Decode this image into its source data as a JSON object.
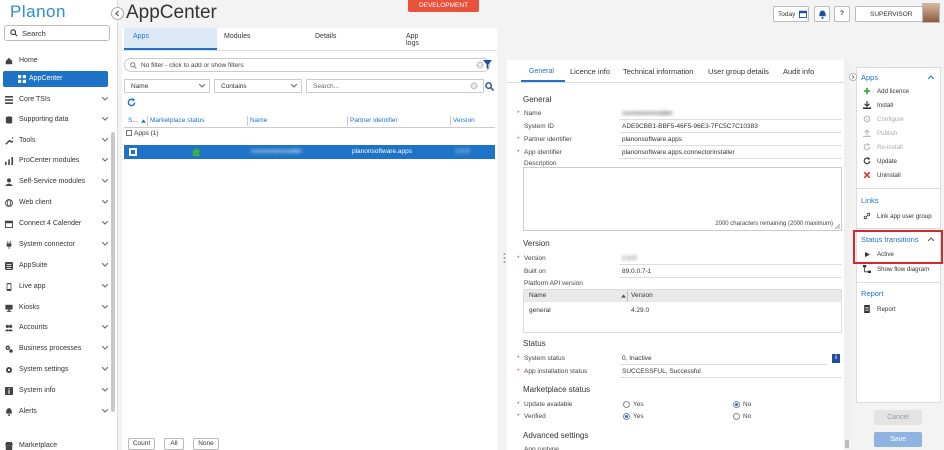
{
  "logo": "Planon",
  "sidebar": {
    "search_label": "Search",
    "items": [
      {
        "label": "Home",
        "icon": "home-icon"
      },
      {
        "label": "AppCenter",
        "icon": "apps-icon"
      },
      {
        "label": "Core TSIs",
        "icon": "grid-icon"
      },
      {
        "label": "Supporting data",
        "icon": "database-icon"
      },
      {
        "label": "Tools",
        "icon": "wrench-icon"
      },
      {
        "label": "ProCenter modules",
        "icon": "chart-icon"
      },
      {
        "label": "Self-Service modules",
        "icon": "user-icon"
      },
      {
        "label": "Web client",
        "icon": "globe-icon"
      },
      {
        "label": "Connect 4 Calender",
        "icon": "calendar-icon"
      },
      {
        "label": "System connector",
        "icon": "plug-icon"
      },
      {
        "label": "AppSuite",
        "icon": "list-icon"
      },
      {
        "label": "Live app",
        "icon": "phone-icon"
      },
      {
        "label": "Kiosks",
        "icon": "monitor-icon"
      },
      {
        "label": "Accounts",
        "icon": "users-icon"
      },
      {
        "label": "Business processes",
        "icon": "gears-icon"
      },
      {
        "label": "System settings",
        "icon": "gear-icon"
      },
      {
        "label": "System info",
        "icon": "info-icon"
      },
      {
        "label": "Alerts",
        "icon": "alert-icon"
      },
      {
        "label": "Marketplace",
        "icon": "store-icon"
      }
    ]
  },
  "header": {
    "title": "AppCenter",
    "environment": "DEVELOPMENT",
    "today": "Today",
    "help": "?",
    "user": "SUPERVISOR"
  },
  "left_tabs": [
    "Apps",
    "Modules",
    "Details",
    "App logs"
  ],
  "filter_text": "No filter - click to add or show filters",
  "condition": {
    "field": "Name",
    "operator": "Contains",
    "value_placeholder": "Search..."
  },
  "grid": {
    "columns": [
      "S...",
      "Marketplace status",
      "Name",
      "Partner identifier",
      "Version"
    ],
    "group_label": "Apps (1)",
    "row": {
      "name": "connectorinstaller",
      "partner": "planonsoftware.apps",
      "version": "1.0.0"
    }
  },
  "bottom_buttons": [
    "Count",
    "All",
    "None"
  ],
  "detail_tabs": [
    "General",
    "Licence info",
    "Technical information",
    "User group details",
    "Audit info"
  ],
  "general": {
    "section": "General",
    "fields": [
      {
        "label": "Name",
        "value": "connectorinstaller",
        "required": true,
        "blur": true
      },
      {
        "label": "System ID",
        "value": "ADE9CBB1-BBF5-46F5-96E3-7FC5C7C10383",
        "required": false,
        "blur": false
      },
      {
        "label": "Partner identifier",
        "value": "planonsoftware.apps",
        "required": true,
        "blur": false
      },
      {
        "label": "App identifier",
        "value": "planonsoftware.apps.connectorinstaller",
        "required": true,
        "blur": false
      }
    ],
    "description_label": "Description",
    "char_count": "2000 characters remaining (2000 maximum)"
  },
  "version": {
    "section": "Version",
    "version_label": "Version",
    "version_value": "1.0.0",
    "built_on_label": "Built on",
    "built_on_value": "89.0.0.7-1",
    "api_label": "Platform API version",
    "api_cols": [
      "Name",
      "Version"
    ],
    "api_row": {
      "name": "general",
      "version": "4.29.0"
    }
  },
  "status": {
    "section": "Status",
    "system_label": "System status",
    "system_value": "0, Inactive",
    "install_label": "App installation status",
    "install_value": "SUCCESSFUL, Successful"
  },
  "marketplace": {
    "section": "Marketplace status",
    "update_label": "Update available",
    "verified_label": "Verified",
    "yes": "Yes",
    "no": "No",
    "update_available": "No",
    "verified": "Yes"
  },
  "advanced": {
    "section": "Advanced settings",
    "first_label": "App runtype"
  },
  "actions": {
    "apps_title": "Apps",
    "apps_items": [
      {
        "label": "Add licence",
        "icon": "plus-icon",
        "enabled": true
      },
      {
        "label": "Install",
        "icon": "download-icon",
        "enabled": true
      },
      {
        "label": "Configure",
        "icon": "configure-icon",
        "enabled": false
      },
      {
        "label": "Publish",
        "icon": "publish-icon",
        "enabled": false
      },
      {
        "label": "Re-install",
        "icon": "reinstall-icon",
        "enabled": false
      },
      {
        "label": "Update",
        "icon": "refresh-icon",
        "enabled": true
      },
      {
        "label": "Uninstall",
        "icon": "close-icon",
        "enabled": true
      }
    ],
    "links_title": "Links",
    "links_items": [
      {
        "label": "Link app user group",
        "icon": "link-icon"
      }
    ],
    "status_title": "Status transitions",
    "status_items": [
      {
        "label": "Active",
        "icon": "arrow-right-icon"
      }
    ],
    "show_flow": "Show flow diagram",
    "report_title": "Report",
    "report_items": [
      {
        "label": "Report",
        "icon": "report-icon"
      }
    ]
  },
  "footer": {
    "cancel": "Cancel",
    "save": "Save"
  },
  "colors": {
    "accent": "#1f73c7",
    "dev_badge": "#e8513a",
    "highlight": "#d9262c"
  }
}
